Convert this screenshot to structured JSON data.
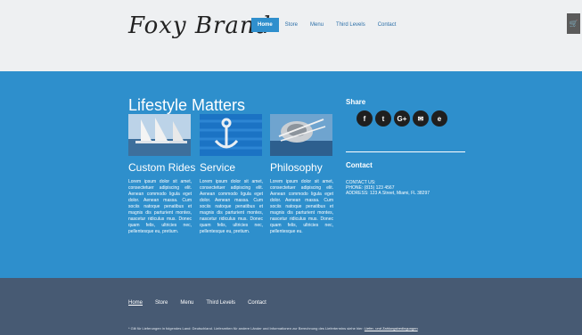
{
  "header": {
    "logo": "Foxy Brand",
    "nav": [
      {
        "label": "Home",
        "active": true
      },
      {
        "label": "Store",
        "active": false
      },
      {
        "label": "Menu",
        "active": false
      },
      {
        "label": "Third Levels",
        "active": false
      },
      {
        "label": "Contact",
        "active": false
      }
    ],
    "cart_icon": "cart-icon"
  },
  "main": {
    "heading": "Lifestyle Matters",
    "columns": [
      {
        "title": "Custom Rides",
        "image": "sailboats",
        "text": "Lorem ipsum dolor sit amet, consectetuer adipiscing elit. Aenean commodo ligula eget dolor. Aenean massa. Cum sociis natoque penatibus et magnis dis parturient montes, nascetur ridiculus mus. Donec quam felis, ultricies nec, pellentesque eu, pretium."
      },
      {
        "title": "Service",
        "image": "anchor",
        "text": "Lorem ipsum dolor sit amet, consectetuer adipiscing elit. Aenean commodo ligula eget dolor. Aenean massa. Cum sociis natoque penatibus et magnis dis parturient montes, nascetur ridiculus mus. Donec quam felis, ultricies nec, pellentesque eu, pretium."
      },
      {
        "title": "Philosophy",
        "image": "winch",
        "text": "Lorem ipsum dolor sit amet, consectetuer adipiscing elit. Aenean commodo ligula eget dolor. Aenean massa. Cum sociis natoque penatibus et magnis dis parturient montes, nascetur ridiculus mus. Donec quam felis, ultricies nec, pellentesque eu."
      }
    ],
    "share": {
      "title": "Share",
      "icons": [
        {
          "name": "facebook-icon",
          "glyph": "f"
        },
        {
          "name": "twitter-icon",
          "glyph": "t"
        },
        {
          "name": "google-plus-icon",
          "glyph": "G+"
        },
        {
          "name": "email-icon",
          "glyph": "✉"
        },
        {
          "name": "evernote-icon",
          "glyph": "e"
        }
      ]
    },
    "contact": {
      "title": "Contact",
      "lines": [
        "CONTACT US:",
        "PHONE: (815) 123 4567",
        "ADDRESS: 123 A Street, Miami, FL 38297"
      ]
    }
  },
  "footer": {
    "nav": [
      {
        "label": "Home",
        "active": true
      },
      {
        "label": "Store",
        "active": false
      },
      {
        "label": "Menu",
        "active": false
      },
      {
        "label": "Third Levels",
        "active": false
      },
      {
        "label": "Contact",
        "active": false
      }
    ],
    "note": "* Gilt für Lieferungen in folgendes Land: Deutschland. Lieferzeiten für andere Länder und Informationen zur Berechnung des Liefertermins siehe hier: ",
    "note_link": "Liefer- und Zahlungsbedingungen"
  },
  "colors": {
    "accent": "#2f8fcd",
    "main_bg": "#2e8fcc",
    "footer_bg": "#475a73"
  }
}
